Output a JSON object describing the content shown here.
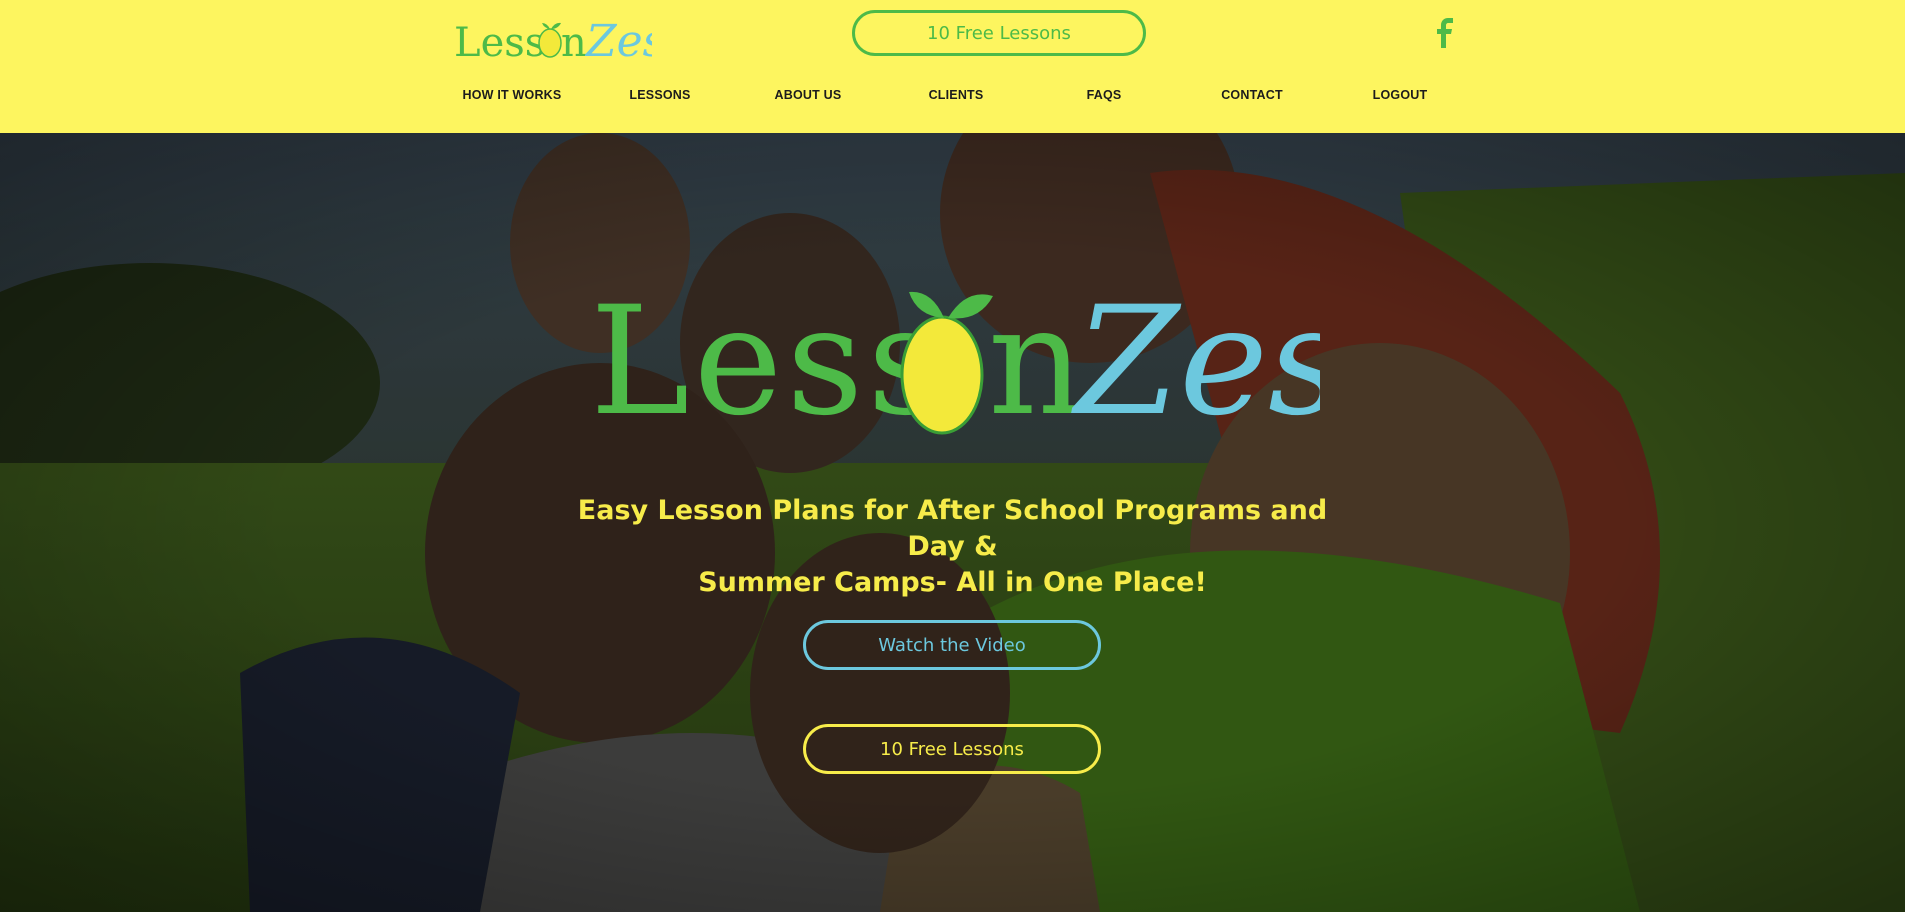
{
  "brand": {
    "logo_part1": "Less",
    "logo_part2": "n",
    "logo_part3": "Zest",
    "colors": {
      "green": "#4dba48",
      "lemon": "#f3e93a",
      "blue": "#6cc8de",
      "header_bg": "#fdf55f"
    }
  },
  "header": {
    "cta_label": "10 Free Lessons",
    "social_icon": "facebook-icon"
  },
  "nav": {
    "items": [
      {
        "label": "HOW IT WORKS"
      },
      {
        "label": "LESSONS"
      },
      {
        "label": "ABOUT US"
      },
      {
        "label": "CLIENTS"
      },
      {
        "label": "FAQS"
      },
      {
        "label": "CONTACT"
      },
      {
        "label": "LOGOUT"
      }
    ]
  },
  "hero": {
    "tagline_line1": "Easy Lesson Plans for After School Programs and Day &",
    "tagline_line2": "Summer Camps- All in One Place!",
    "video_button": "Watch the Video",
    "free_button": "10 Free Lessons"
  }
}
